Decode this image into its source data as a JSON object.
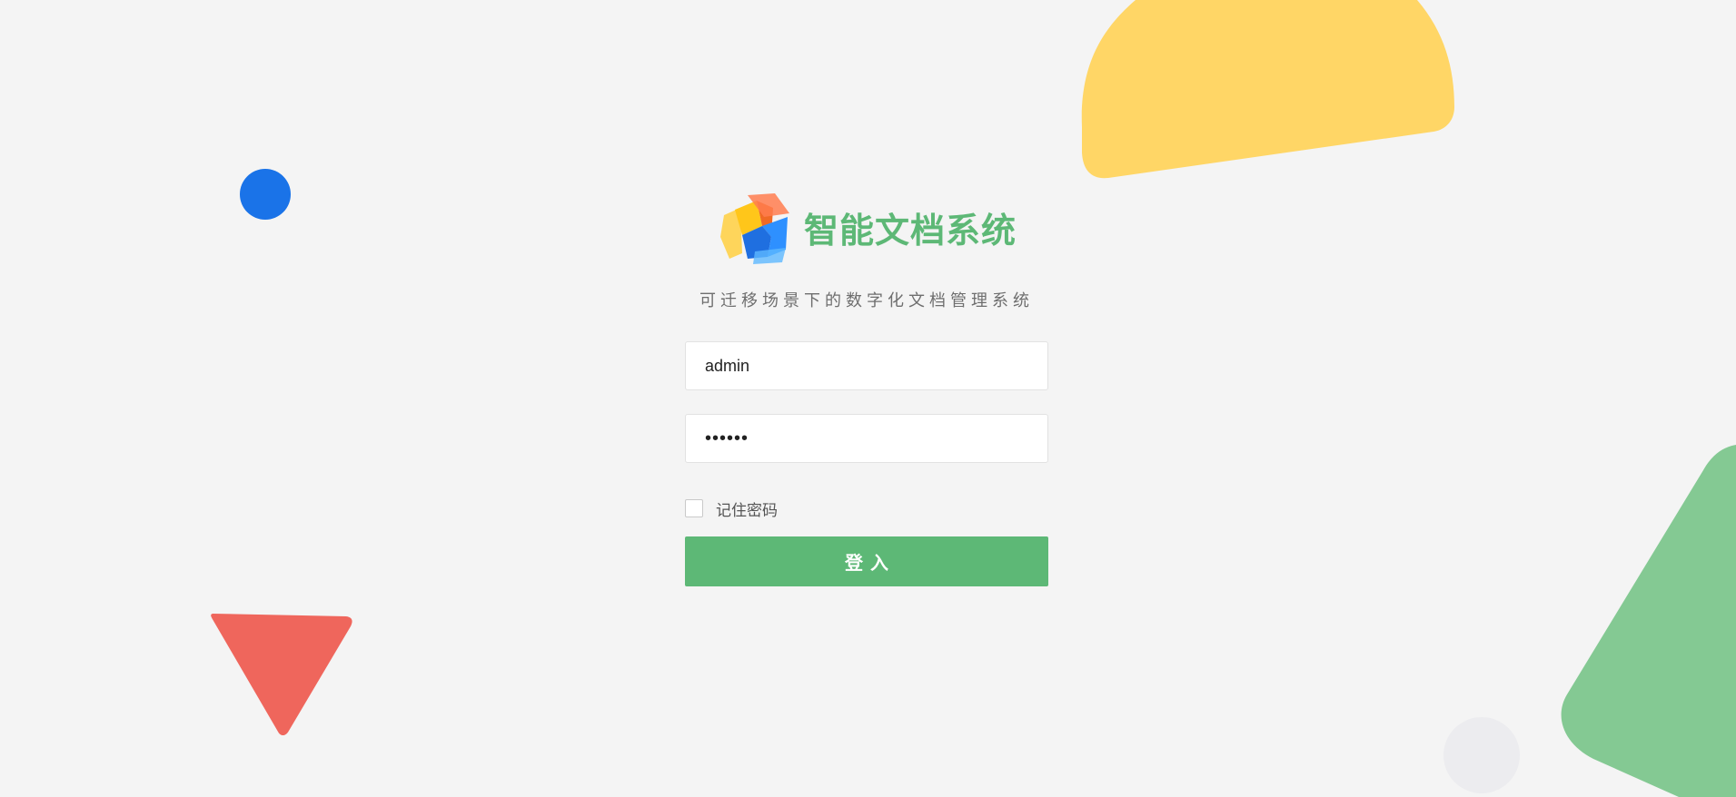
{
  "brand": {
    "logo_icon": "cube-logo-icon",
    "title": "智能文档系统",
    "subtitle": "可迁移场景下的数字化文档管理系统"
  },
  "login_form": {
    "username_value": "admin",
    "password_value": "123456",
    "remember_label": "记住密码",
    "remember_checked": false,
    "submit_label": "登入"
  },
  "colors": {
    "background": "#f4f4f4",
    "accent_green": "#5db876",
    "decor_yellow": "#ffd666",
    "decor_blue": "#1a73e8",
    "decor_red": "#ef665c",
    "decor_green": "#84c993"
  }
}
